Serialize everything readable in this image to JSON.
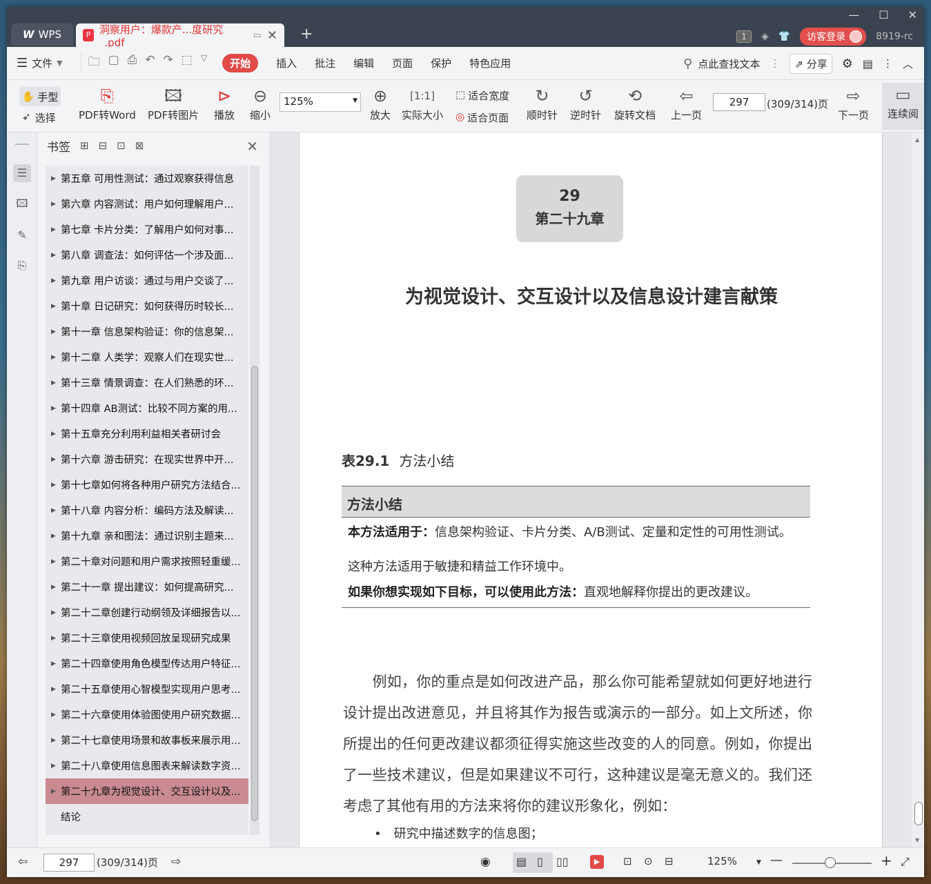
{
  "titlebar": {
    "app_label": "WPS",
    "doc_tab_title": "洞察用户：爆款产...度研究_.pdf",
    "page_badge": "1",
    "login_label": "访客登录",
    "user_id": "8919-rc"
  },
  "menubar": {
    "file": "文件",
    "tabs": [
      "开始",
      "插入",
      "批注",
      "编辑",
      "页面",
      "保护",
      "特色应用"
    ],
    "search": "点此查找文本",
    "share": "分享"
  },
  "toolbar": {
    "hand": "手型",
    "select": "选择",
    "pdf_to_word": "PDF转Word",
    "pdf_to_image": "PDF转图片",
    "play": "播放",
    "zoom_out": "缩小",
    "zoom_value": "125%",
    "zoom_in": "放大",
    "actual_size": "实际大小",
    "fit_width": "适合宽度",
    "fit_page": "适合页面",
    "clockwise": "顺时针",
    "counter_clockwise": "逆时针",
    "rotate_doc": "旋转文档",
    "prev_page": "上一页",
    "page_number": "297",
    "page_total": "(309/314)页",
    "next_page": "下一页",
    "continuous": "连续阅"
  },
  "bookmarks": {
    "title": "书签",
    "items": [
      "第五章 可用性测试：通过观察获得信息",
      "第六章 内容测试：用户如何理解用户...",
      "第七章 卡片分类：了解用户如何对事...",
      "第八章 调查法：如何评估一个涉及面...",
      "第九章 用户访谈：通过与用户交谈了...",
      "第十章 日记研究：如何获得历时较长...",
      "第十一章 信息架构验证：你的信息架...",
      "第十二章 人类学：观察人们在现实世...",
      "第十三章 情景调查：在人们熟悉的环...",
      "第十四章 AB测试：比较不同方案的用...",
      "第十五章充分利用利益相关者研讨会",
      "第十六章 游击研究：在现实世界中开...",
      "第十七章如何将各种用户研究方法结合...",
      "第十八章 内容分析：编码方法及解读...",
      "第十九章 亲和图法：通过识别主题来...",
      "第二十章对问题和用户需求按照轻重缓...",
      "第二十一章 提出建议：如何提高研究...",
      "第二十二章创建行动纲领及详细报告以...",
      "第二十三章使用视频回放呈现研究成果",
      "第二十四章使用角色模型传达用户特征...",
      "第二十五章使用心智模型实现用户思考...",
      "第二十六章使用体验图使用户研究数据...",
      "第二十七章使用场景和故事板来展示用...",
      "第二十八章使用信息图表来解读数字资...",
      "第二十九章为视觉设计、交互设计以及...",
      "结论"
    ],
    "selected_index": 24
  },
  "document": {
    "chapter_number": "29",
    "chapter_label": "第二十九章",
    "title": "为视觉设计、交互设计以及信息设计建言献策",
    "table_caption_num": "表29.1",
    "table_caption_text": "方法小结",
    "table_header": "方法小结",
    "row1_label": "本方法适用于：",
    "row1_text": "信息架构验证、卡片分类、A/B测试、定量和定性的可用性测试。",
    "row2_text": "这种方法适用于敏捷和精益工作环境中。",
    "row3_label": "如果你想实现如下目标，可以使用此方法：",
    "row3_text": "直观地解释你提出的更改建议。",
    "paragraph": "　　例如，你的重点是如何改进产品，那么你可能希望就如何更好地进行设计提出改进意见，并且将其作为报告或演示的一部分。如上文所述，你所提出的任何更改建议都须征得实施这些改变的人的同意。例如，你提出了一些技术建议，但是如果建议不可行，这种建议是毫无意义的。我们还考虑了其他有用的方法来将你的建议形象化，例如：",
    "bullet": "研究中描述数字的信息图；"
  },
  "statusbar": {
    "page_number": "297",
    "page_total": "(309/314)页",
    "zoom": "125%"
  }
}
